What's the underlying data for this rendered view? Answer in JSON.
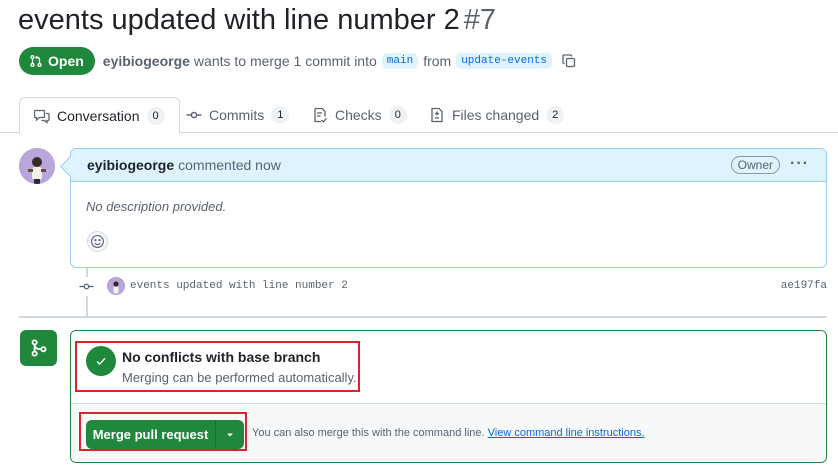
{
  "pr": {
    "title": "events updated with line number 2",
    "number": "#7",
    "state": "Open",
    "author": "eyibiogeorge",
    "merge_text_a": "wants to merge 1 commit into",
    "base_branch": "main",
    "merge_text_b": "from",
    "head_branch": "update-events"
  },
  "tabs": [
    {
      "label": "Conversation",
      "count": "0"
    },
    {
      "label": "Commits",
      "count": "1"
    },
    {
      "label": "Checks",
      "count": "0"
    },
    {
      "label": "Files changed",
      "count": "2"
    }
  ],
  "comment": {
    "author": "eyibiogeorge",
    "action": "commented now",
    "badge": "Owner",
    "menu": "···",
    "body": "No description provided."
  },
  "commit": {
    "message": "events updated with line number 2",
    "sha": "ae197fa"
  },
  "merge": {
    "status_title": "No conflicts with base branch",
    "status_sub": "Merging can be performed automatically.",
    "button_label": "Merge pull request",
    "cmd_text": "You can also merge this with the command line.",
    "cmd_link": "View command line instructions."
  },
  "colors": {
    "success": "#1f883d",
    "link": "#0969da",
    "highlight": "#d9232d",
    "comment_border": "#9ecbff",
    "comment_header_bg": "#ddf4ff"
  },
  "icons": {
    "state": "git-pull-request-icon",
    "copy": "copy-icon",
    "conversation_tab": "comment-discussion-icon",
    "commits_tab": "git-commit-icon",
    "checks_tab": "checklist-icon",
    "files_tab": "file-diff-icon",
    "emoji": "smiley-icon",
    "commit_node": "git-commit-icon",
    "merge_state": "git-merge-icon",
    "status": "check-icon",
    "dropdown": "triangle-down-icon"
  }
}
